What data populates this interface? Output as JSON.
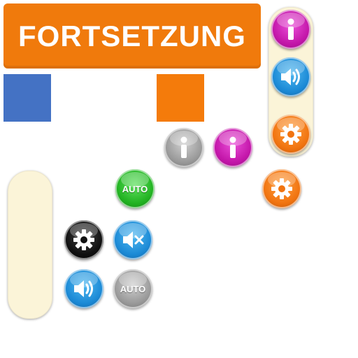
{
  "continue_button": {
    "label": "FORTSETZUNG"
  },
  "auto_buttons": {
    "green_label": "AUTO",
    "grey_label": "AUTO"
  },
  "icons": {
    "info": "info-icon",
    "sound_on": "speaker-on-icon",
    "sound_off": "speaker-muted-icon",
    "settings": "gear-icon"
  },
  "colors": {
    "orange": "#f07a0c",
    "blue": "#4472c4",
    "magenta": "#c316a9",
    "cream": "#fbf4d8"
  }
}
